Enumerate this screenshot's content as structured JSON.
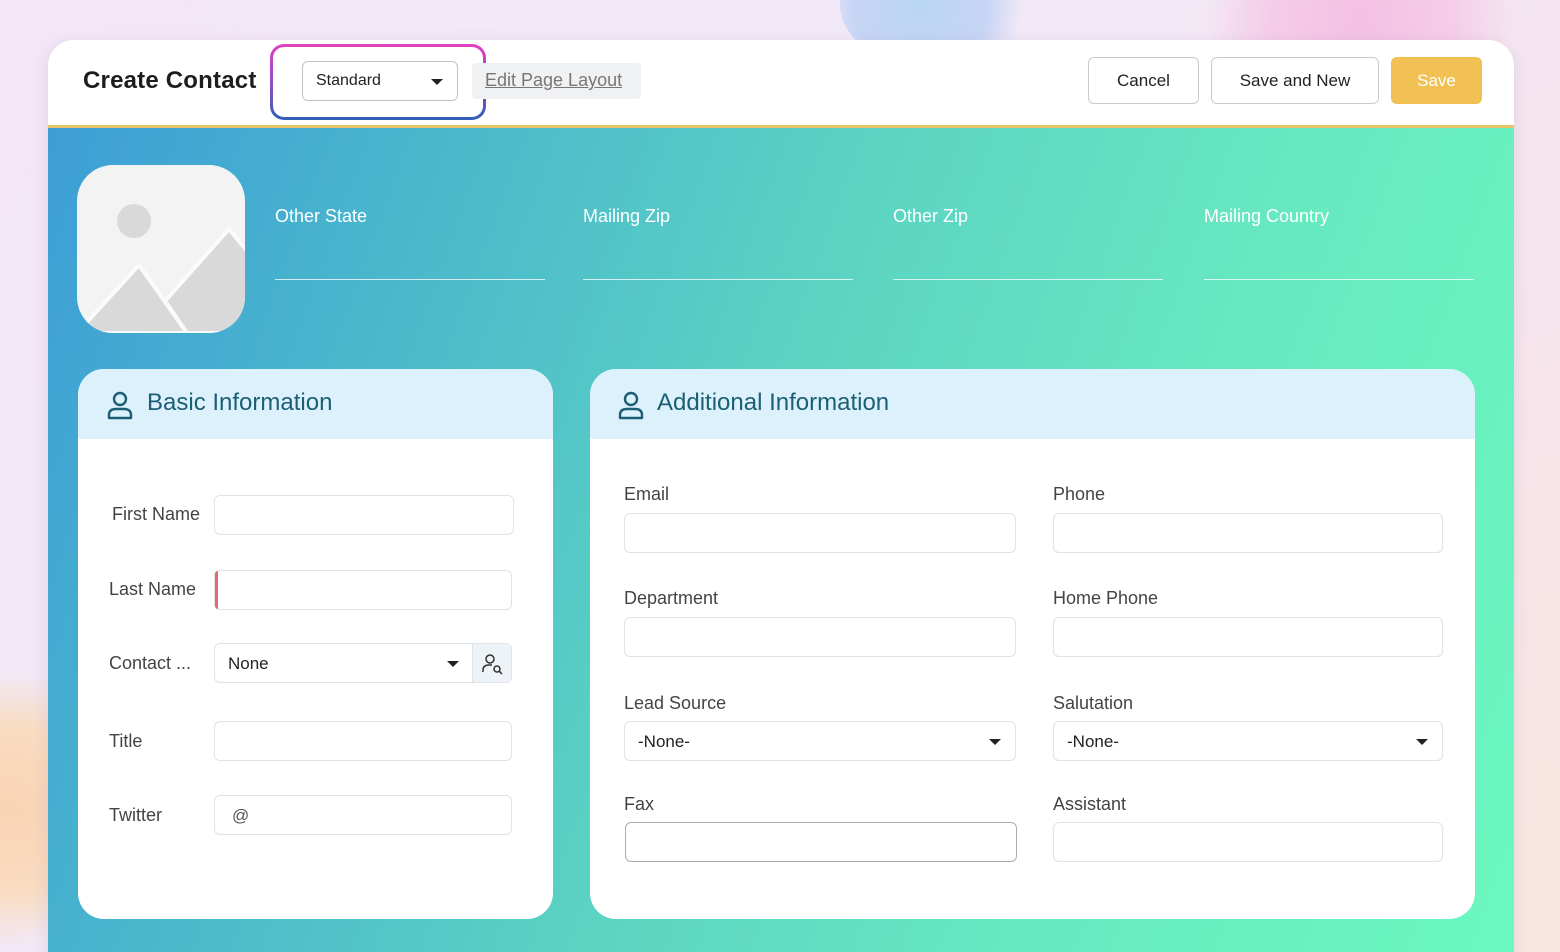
{
  "header": {
    "title": "Create Contact",
    "layout_select": {
      "value": "Standard"
    },
    "edit_layout_label": "Edit Page Layout",
    "buttons": {
      "cancel": "Cancel",
      "save_and_new": "Save and New",
      "save": "Save"
    }
  },
  "top_fields": [
    {
      "label": "Other State",
      "value": ""
    },
    {
      "label": "Mailing Zip",
      "value": ""
    },
    {
      "label": "Other Zip",
      "value": ""
    },
    {
      "label": "Mailing Country",
      "value": ""
    }
  ],
  "basic_information": {
    "title": "Basic Information",
    "fields": {
      "first_name": {
        "label": "First Name",
        "value": ""
      },
      "last_name": {
        "label": "Last Name",
        "value": ""
      },
      "contact_owner": {
        "label": "Contact ...",
        "value": "None"
      },
      "title": {
        "label": "Title",
        "value": ""
      },
      "twitter": {
        "label": "Twitter",
        "prefix": "@",
        "value": ""
      }
    }
  },
  "additional_information": {
    "title": "Additional Information",
    "fields": {
      "email": {
        "label": "Email",
        "value": ""
      },
      "phone": {
        "label": "Phone",
        "value": ""
      },
      "department": {
        "label": "Department",
        "value": ""
      },
      "home_phone": {
        "label": "Home Phone",
        "value": ""
      },
      "lead_source": {
        "label": "Lead Source",
        "value": "-None-"
      },
      "salutation": {
        "label": "Salutation",
        "value": "-None-"
      },
      "fax": {
        "label": "Fax",
        "value": ""
      },
      "assistant": {
        "label": "Assistant",
        "value": ""
      }
    }
  },
  "colors": {
    "save_button": "#f2c155",
    "accent_border": "#e8c36a",
    "card_header_bg": "#dcf1fb",
    "card_title": "#1b5f75",
    "required_marker": "#e66a6a",
    "highlight_gradient": [
      "#e040c0",
      "#2f5fb8"
    ]
  },
  "icons": {
    "photo": "image-placeholder-icon",
    "section": "user-icon",
    "lookup": "user-search-icon",
    "dropdown": "caret-down-icon"
  }
}
